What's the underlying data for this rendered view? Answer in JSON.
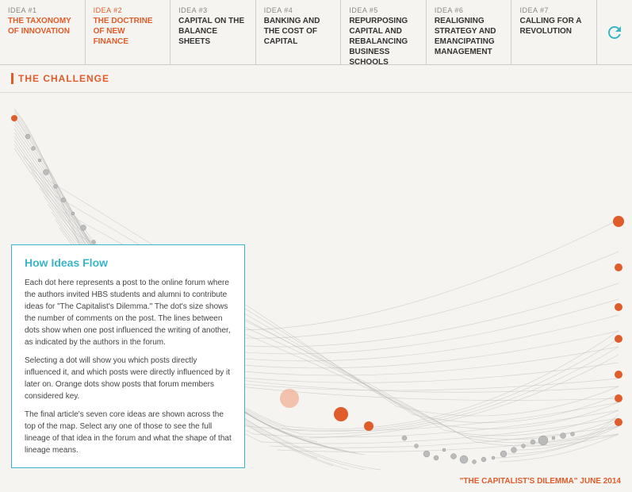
{
  "nav": {
    "items": [
      {
        "id": "idea1",
        "num": "IDEA #1",
        "title": "THE TAXONOMY OF INNOVATION",
        "active": false
      },
      {
        "id": "idea2",
        "num": "IDEA #2",
        "title": "THE DOCTRINE OF NEW FINANCE",
        "active": true
      },
      {
        "id": "idea3",
        "num": "IDEA #3",
        "title": "CAPITAL ON THE BALANCE SHEETS",
        "active": false
      },
      {
        "id": "idea4",
        "num": "IDEA #4",
        "title": "BANKING AND THE COST OF CAPITAL",
        "active": false
      },
      {
        "id": "idea5",
        "num": "IDEA #5",
        "title": "REPURPOSING CAPITAL AND REBALANCING BUSINESS SCHOOLS",
        "active": false
      },
      {
        "id": "idea6",
        "num": "IDEA #6",
        "title": "REALIGNING STRATEGY AND EMANCIPATING MANAGEMENT",
        "active": false
      },
      {
        "id": "idea7",
        "num": "IDEA #7",
        "title": "CALLING FOR A REVOLUTION",
        "active": false
      }
    ]
  },
  "challenge_label": "THE CHALLENGE",
  "info_box": {
    "title": "How Ideas Flow",
    "para1": "Each dot here represents a post to the online forum where the authors invited HBS students and alumni to contribute ideas for \"The Capitalist's Dilemma.\" The dot's size shows the number of comments on the post. The lines between dots show when one post influenced the writing of another, as indicated by the authors in the forum.",
    "para2": "Selecting a dot will show you which posts directly influenced it, and which posts were directly influenced by it later on. Orange dots show posts that forum members considered key.",
    "para3": "The final article's seven core ideas are shown across the top of the map. Select any one of those to see the full lineage of that idea in the forum and what the shape of that lineage means."
  },
  "footer": {
    "label": "\"THE CAPITALIST'S DILEMMA\" JUNE 2014"
  }
}
